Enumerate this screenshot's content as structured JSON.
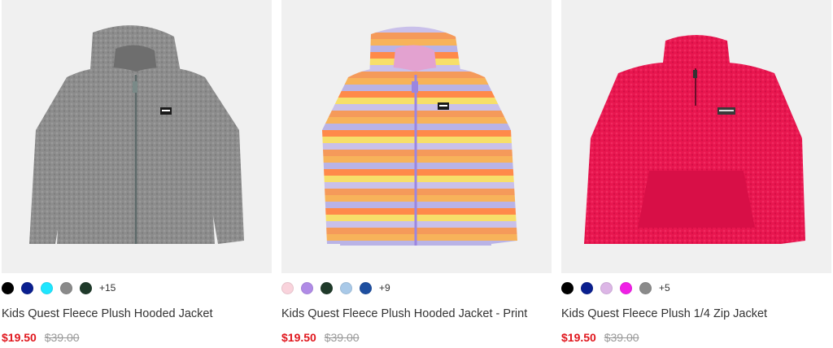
{
  "products": [
    {
      "title": "Kids Quest Fleece Plush Hooded Jacket",
      "sale_price": "$19.50",
      "original_price": "$39.00",
      "swatches": [
        "#000000",
        "#0a1f8f",
        "#1ee6ff",
        "#8a8a8a",
        "#1f3a2a"
      ],
      "more_colors": "+15",
      "image": "gray-hooded-fleece-jacket"
    },
    {
      "title": "Kids Quest Fleece Plush Hooded Jacket - Print",
      "sale_price": "$19.50",
      "original_price": "$39.00",
      "swatches": [
        "#f9d3dc",
        "#b08be6",
        "#1f3a2a",
        "#a9c9e8",
        "#1e4fa0"
      ],
      "more_colors": "+9",
      "image": "striped-print-hooded-fleece-jacket"
    },
    {
      "title": "Kids Quest Fleece Plush 1/4 Zip Jacket",
      "sale_price": "$19.50",
      "original_price": "$39.00",
      "swatches": [
        "#000000",
        "#0a1f8f",
        "#dcb6e6",
        "#f01fe6",
        "#8a8a8a"
      ],
      "more_colors": "+5",
      "image": "pink-quarter-zip-fleece-jacket"
    }
  ],
  "colors": {
    "sale": "#e0161d",
    "original": "#999999",
    "image_bg": "#f0f0f0"
  }
}
